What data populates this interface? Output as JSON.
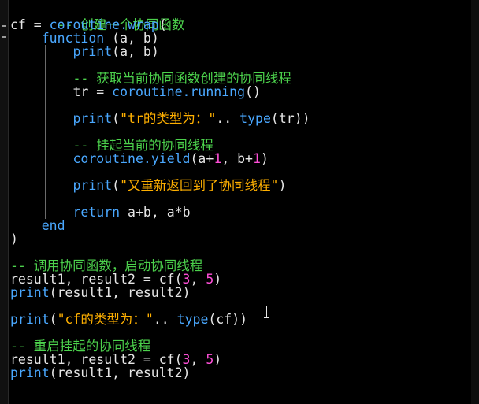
{
  "code": {
    "l1_comment": "-- 创建一个协同函数",
    "l2": {
      "a": "cf = ",
      "b": "coroutine.wrap",
      "c": "("
    },
    "l3": {
      "a": "function",
      "b": " (a, b)"
    },
    "l4": {
      "a": "print",
      "b": "(a, b)"
    },
    "l6_comment": "-- 获取当前协同函数创建的协同线程",
    "l7": {
      "a": "tr = ",
      "b": "coroutine.running",
      "c": "()"
    },
    "l9": {
      "a": "print",
      "b": "(",
      "c": "\"tr的类型为：\"",
      "d": ".. ",
      "e": "type",
      "f": "(tr))"
    },
    "l11_comment": "-- 挂起当前的协同线程",
    "l12": {
      "a": "coroutine.yield",
      "b": "(a+",
      "c": "1",
      "d": ", b+",
      "e": "1",
      "f": ")"
    },
    "l14": {
      "a": "print",
      "b": "(",
      "c": "\"又重新返回到了协同线程\"",
      "d": ")"
    },
    "l16": {
      "a": "return",
      "b": " a+b, a*b"
    },
    "l17": {
      "a": "end"
    },
    "l18": {
      "a": ")"
    },
    "l20_comment": "-- 调用协同函数，启动协同线程",
    "l21": {
      "a": "result1, result2 = cf(",
      "b": "3",
      "c": ", ",
      "d": "5",
      "e": ")"
    },
    "l22": {
      "a": "print",
      "b": "(result1, result2)"
    },
    "l24": {
      "a": "print",
      "b": "(",
      "c": "\"cf的类型为：\"",
      "d": ".. ",
      "e": "type",
      "f": "(cf))"
    },
    "l26_comment": "-- 重启挂起的协同线程",
    "l27": {
      "a": "result1, result2 = cf(",
      "b": "3",
      "c": ", ",
      "d": "5",
      "e": ")"
    },
    "l28": {
      "a": "print",
      "b": "(result1, result2)"
    }
  },
  "colors": {
    "background": "#000000",
    "comment": "#4cd14c",
    "keyword": "#4aa8ff",
    "string": "#ffb000",
    "number": "#ff4fd8",
    "plain": "#e6e6e6"
  }
}
